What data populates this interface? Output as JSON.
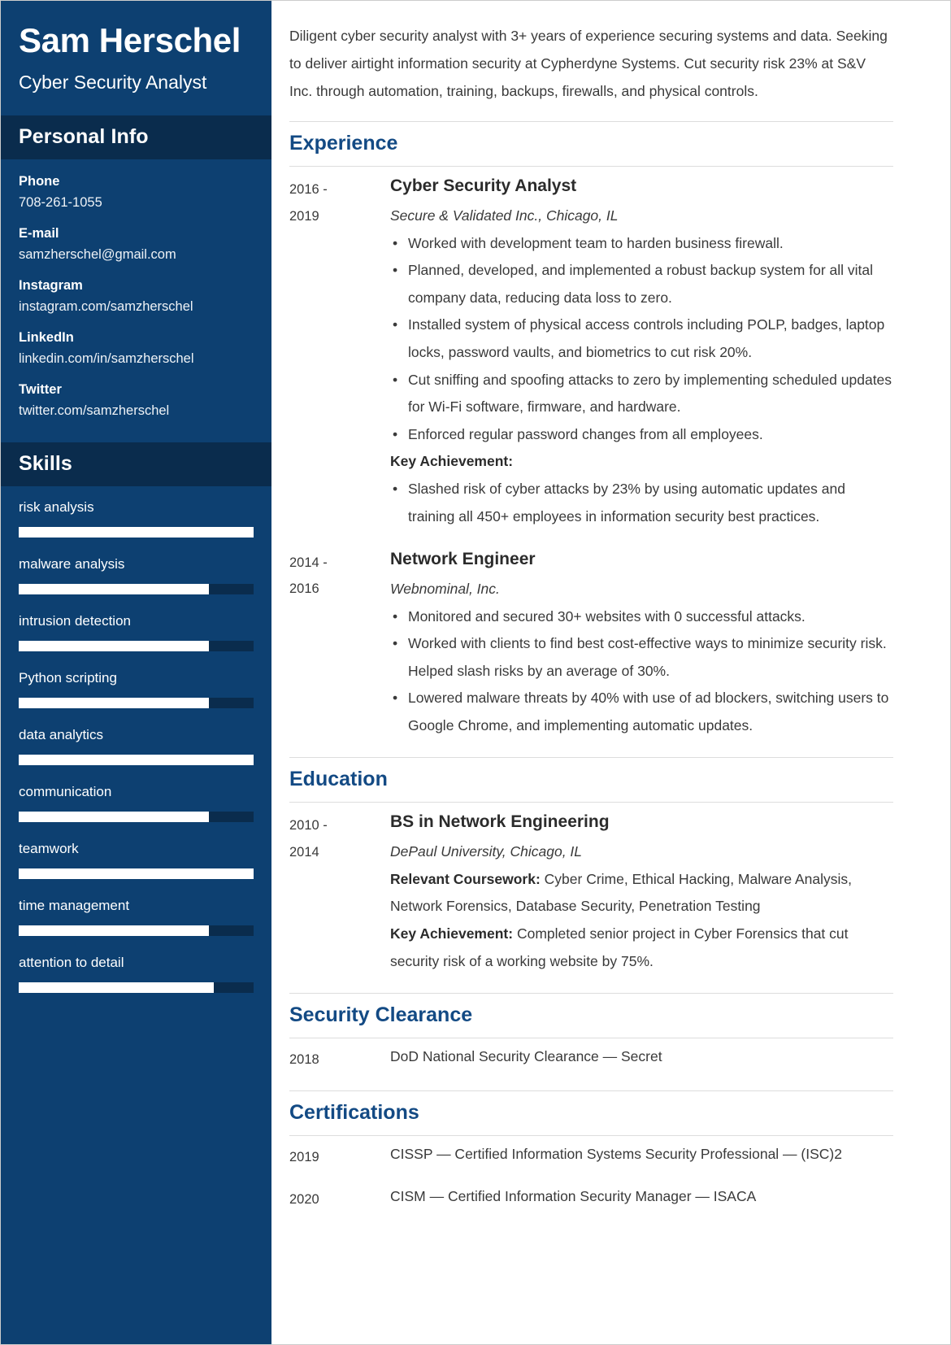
{
  "sidebar": {
    "name": "Sam Herschel",
    "job_title": "Cyber Security Analyst",
    "personal_info_heading": "Personal Info",
    "contacts": [
      {
        "label": "Phone",
        "value": "708-261-1055"
      },
      {
        "label": "E-mail",
        "value": "samzherschel@gmail.com"
      },
      {
        "label": "Instagram",
        "value": "instagram.com/samzherschel"
      },
      {
        "label": "LinkedIn",
        "value": "linkedin.com/in/samzherschel"
      },
      {
        "label": "Twitter",
        "value": "twitter.com/samzherschel"
      }
    ],
    "skills_heading": "Skills",
    "skills": [
      {
        "name": "risk analysis",
        "level": 100
      },
      {
        "name": "malware analysis",
        "level": 81
      },
      {
        "name": "intrusion detection",
        "level": 81
      },
      {
        "name": "Python scripting",
        "level": 81
      },
      {
        "name": "data analytics",
        "level": 100
      },
      {
        "name": "communication",
        "level": 81
      },
      {
        "name": "teamwork",
        "level": 100
      },
      {
        "name": "time management",
        "level": 81
      },
      {
        "name": "attention to detail",
        "level": 83
      }
    ]
  },
  "main": {
    "summary": "Diligent cyber security analyst with 3+ years of experience securing systems and data. Seeking to deliver airtight information security at Cypherdyne Systems. Cut security risk 23% at S&V Inc. through automation, training, backups, firewalls, and physical controls.",
    "experience_heading": "Experience",
    "experience": [
      {
        "dates_from": "2016 -",
        "dates_to": "2019",
        "role": "Cyber Security Analyst",
        "org": "Secure & Validated Inc., Chicago, IL",
        "bullets": [
          "Worked with development team to harden business firewall.",
          "Planned, developed, and implemented a robust backup system for all vital company data, reducing data loss to zero.",
          "Installed system of physical access controls including POLP, badges, laptop locks, password vaults, and biometrics to cut risk 20%.",
          "Cut sniffing and spoofing attacks to zero by implementing scheduled updates for Wi-Fi software, firmware, and hardware.",
          "Enforced regular password changes from all employees."
        ],
        "key_achievement_label": "Key Achievement:",
        "key_achievement_bullets": [
          "Slashed risk of cyber attacks by 23% by using automatic updates and training all 450+ employees in information security best practices."
        ]
      },
      {
        "dates_from": "2014 -",
        "dates_to": "2016",
        "role": "Network Engineer",
        "org": "Webnominal, Inc.",
        "bullets": [
          "Monitored and secured 30+ websites with 0 successful attacks.",
          "Worked with clients to find best cost-effective ways to minimize security risk. Helped slash risks by an average of 30%.",
          "Lowered malware threats by 40% with use of ad blockers, switching users to Google Chrome, and implementing automatic updates."
        ],
        "key_achievement_label": "",
        "key_achievement_bullets": []
      }
    ],
    "education_heading": "Education",
    "education": [
      {
        "dates_from": "2010 -",
        "dates_to": "2014",
        "degree": "BS in Network Engineering",
        "school": "DePaul University, Chicago, IL",
        "coursework_label": "Relevant Coursework:",
        "coursework_value": "Cyber Crime, Ethical Hacking, Malware Analysis, Network Forensics, Database Security, Penetration Testing",
        "achievement_label": "Key Achievement:",
        "achievement_value": "Completed senior project in Cyber Forensics that cut security risk of a working website by 75%."
      }
    ],
    "clearance_heading": "Security Clearance",
    "clearance": [
      {
        "year": "2018",
        "text": "DoD National Security Clearance — Secret"
      }
    ],
    "certifications_heading": "Certifications",
    "certifications": [
      {
        "year": "2019",
        "text": "CISSP — Certified Information Systems Security Professional — (ISC)2"
      },
      {
        "year": "2020",
        "text": "CISM — Certified Information Security Manager — ISACA"
      }
    ]
  }
}
